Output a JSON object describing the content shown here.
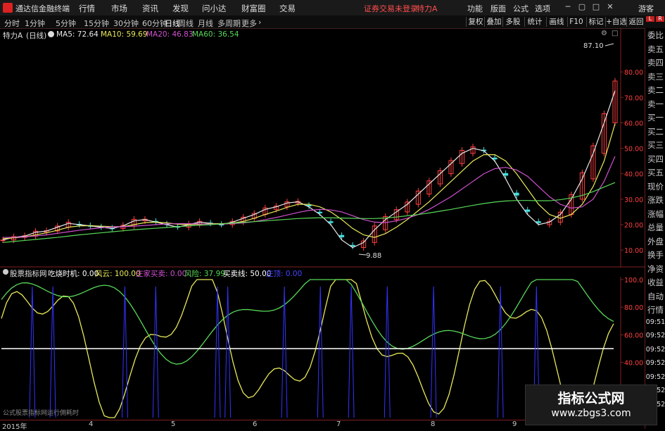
{
  "app": {
    "title": "通达信金融终端"
  },
  "menu": [
    "行情",
    "市场",
    "资讯",
    "发现",
    "问小达",
    "财富圈",
    "交易"
  ],
  "status": {
    "message": "证券交易未登录",
    "stock": "特力A"
  },
  "right_menu": [
    "功能",
    "版面",
    "公式",
    "选项"
  ],
  "guest": "游客",
  "periods": [
    "分时",
    "1分钟",
    "5分钟",
    "15分钟",
    "30分钟",
    "60分钟",
    "日线",
    "周线",
    "月线",
    "多周期",
    "更多"
  ],
  "active_period": "日线",
  "toolbar": [
    "复权",
    "叠加",
    "多股",
    "统计",
    "画线",
    "F10",
    "标记",
    "+自选",
    "返回"
  ],
  "main_chart": {
    "stock_label": "特力A",
    "period_label": "(日线)",
    "ma": [
      {
        "label": "MA5: 72.64",
        "color": "#e8e8e8"
      },
      {
        "label": "MA10: 59.69",
        "color": "#e8e85a"
      },
      {
        "label": "MA20: 46.83",
        "color": "#d050d0"
      },
      {
        "label": "MA60: 36.54",
        "color": "#58d858"
      }
    ],
    "y_ticks": [
      "80.00",
      "70.00",
      "60.00",
      "50.00",
      "40.00",
      "30.00",
      "20.00",
      "10.00"
    ],
    "high_label": "87.10",
    "low_label": "9.88"
  },
  "indicator": {
    "title": "股票指标网",
    "items": [
      {
        "label": "吃烧时机: 0.00",
        "color": "#ffffff"
      },
      {
        "label": "风云: 100.00",
        "color": "#e8e85a"
      },
      {
        "label": "庄家买卖: 0.00",
        "color": "#d050d0"
      },
      {
        "label": "风险: 37.99",
        "color": "#58d858"
      },
      {
        "label": "买卖线: 50.00",
        "color": "#ffffff"
      },
      {
        "label": "庄顶: 0.00",
        "color": "#4444ff"
      }
    ],
    "y_ticks": [
      "100.0",
      "80.00",
      "60.00",
      "40.00"
    ],
    "bottom_note": "公式股票指标网运行佣耗时"
  },
  "time_axis": {
    "year": "2015年",
    "months": [
      "4",
      "5",
      "6",
      "7",
      "8",
      "9"
    ]
  },
  "right_panel": {
    "items": [
      "委比",
      "卖五",
      "卖四",
      "卖三",
      "卖二",
      "卖一",
      "买一",
      "买二",
      "买三",
      "买四",
      "买五",
      "现价",
      "涨跌",
      "涨幅",
      "总量",
      "外盘",
      "换手",
      "净资",
      "收益",
      "自动",
      "行情",
      "09:51",
      "09:52",
      "09:52",
      "09:52",
      "09:52",
      "09:52",
      "09:52"
    ]
  },
  "watermark": {
    "line1": "指标公式网",
    "line2": "www.zbgs3.com"
  },
  "chart_data": {
    "type": "line",
    "title": "特力A (日线)",
    "ylim": [
      7,
      90
    ],
    "y_ticks": [
      80,
      70,
      60,
      50,
      40,
      30,
      20,
      10
    ],
    "series": [
      {
        "name": "MA5",
        "values": [
          14,
          15,
          15.5,
          17,
          17.5,
          19,
          20.5,
          20,
          19.5,
          19,
          18.5,
          19.5,
          21.5,
          22,
          21,
          20,
          19,
          20,
          21,
          20.5,
          20,
          21,
          22.5,
          24,
          26,
          27,
          28.5,
          29,
          27,
          24,
          20,
          14,
          11,
          13,
          18,
          22,
          25,
          28,
          32,
          36,
          40,
          44,
          48,
          50,
          49,
          45,
          38,
          30,
          24,
          20,
          21,
          24,
          30,
          38,
          48,
          60,
          72.64
        ]
      },
      {
        "name": "MA10",
        "values": [
          14.5,
          14.8,
          15.2,
          16,
          16.8,
          17.8,
          19,
          19.5,
          19.6,
          19.4,
          19.2,
          19.2,
          20,
          20.8,
          21,
          20.7,
          20.2,
          20,
          20.2,
          20.4,
          20.4,
          20.6,
          21.3,
          22.5,
          24,
          25.3,
          26.8,
          28,
          28,
          27,
          25,
          22,
          18.5,
          16,
          15,
          16.5,
          19,
          22,
          25.5,
          29,
          33,
          37,
          41,
          45,
          47.5,
          47.5,
          45,
          40,
          34,
          28,
          24,
          22.5,
          24,
          28,
          35,
          45,
          59.69
        ]
      },
      {
        "name": "MA20",
        "values": [
          15,
          15,
          15.2,
          15.6,
          16,
          16.6,
          17.2,
          17.8,
          18.3,
          18.8,
          19.1,
          19.2,
          19.4,
          19.7,
          20,
          20.3,
          20.4,
          20.4,
          20.3,
          20.2,
          20.2,
          20.4,
          20.7,
          21.2,
          22,
          22.8,
          23.8,
          24.8,
          25.6,
          26,
          25.8,
          25,
          23.5,
          22,
          21,
          20.8,
          21.5,
          22.5,
          24,
          26,
          28.5,
          31,
          34,
          37,
          40,
          42,
          42.5,
          41.5,
          39,
          35,
          31,
          28,
          26.5,
          27,
          30,
          37,
          46.83
        ]
      },
      {
        "name": "MA60",
        "values": [
          13,
          13.4,
          13.8,
          14.2,
          14.6,
          15,
          15.5,
          16,
          16.4,
          16.8,
          17.2,
          17.6,
          18,
          18.3,
          18.6,
          18.9,
          19.2,
          19.5,
          19.8,
          20,
          20.3,
          20.6,
          20.9,
          21.2,
          21.5,
          21.8,
          22.1,
          22.4,
          22.6,
          22.7,
          22.7,
          22.6,
          22.5,
          22.4,
          22.4,
          22.6,
          23,
          23.5,
          24,
          24.6,
          25.3,
          26,
          26.8,
          27.6,
          28.3,
          28.9,
          29.3,
          29.5,
          29.5,
          29.4,
          29.4,
          29.8,
          30.5,
          31.5,
          33,
          34.8,
          36.54
        ]
      }
    ],
    "annotations": [
      {
        "text": "87.10"
      },
      {
        "text": "9.88"
      }
    ]
  }
}
